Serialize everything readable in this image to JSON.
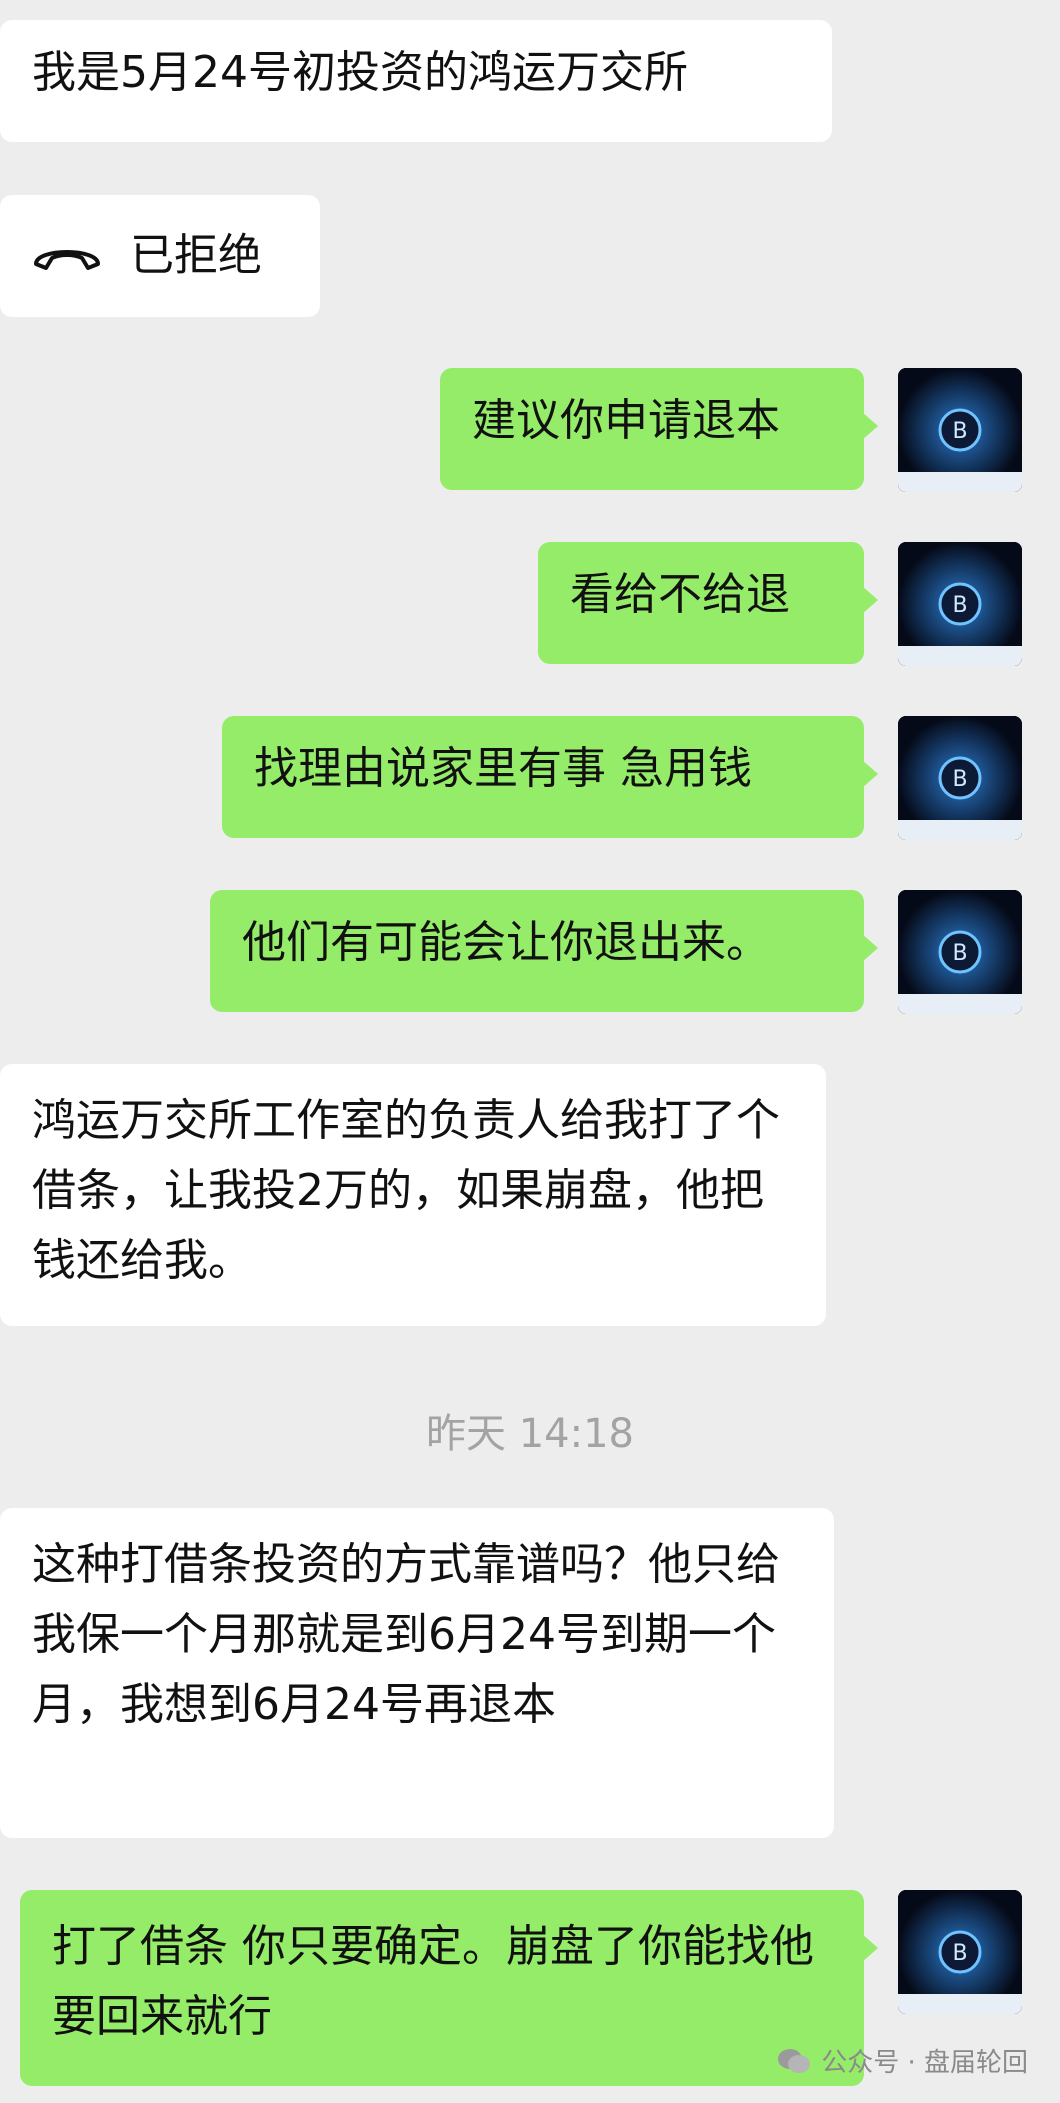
{
  "messages": [
    {
      "text": "我是5月24号初投资的鸿运万交所"
    },
    {
      "text": "已拒绝",
      "icon": "phone-declined-icon"
    },
    {
      "text": "建议你申请退本"
    },
    {
      "text": "看给不给退"
    },
    {
      "text": "找理由说家里有事 急用钱"
    },
    {
      "text": "他们有可能会让你退出来。"
    },
    {
      "text": "鸿运万交所工作室的负责人给我打了个借条，让我投2万的，如果崩盘，他把钱还给我。"
    },
    {
      "text": "这种打借条投资的方式靠谱吗？他只给我保一个月那就是到6月24号到期一个月，我想到6月24号再退本"
    },
    {
      "text": "打了借条 你只要确定。崩盘了你能找他要回来就行"
    }
  ],
  "timestamp": "昨天 14:18",
  "watermark": {
    "text": "公众号 · 盘届轮回",
    "icon": "wechat-icon"
  },
  "colors": {
    "incoming": "#ffffff",
    "outgoing": "#95ec69",
    "background": "#ededed"
  }
}
